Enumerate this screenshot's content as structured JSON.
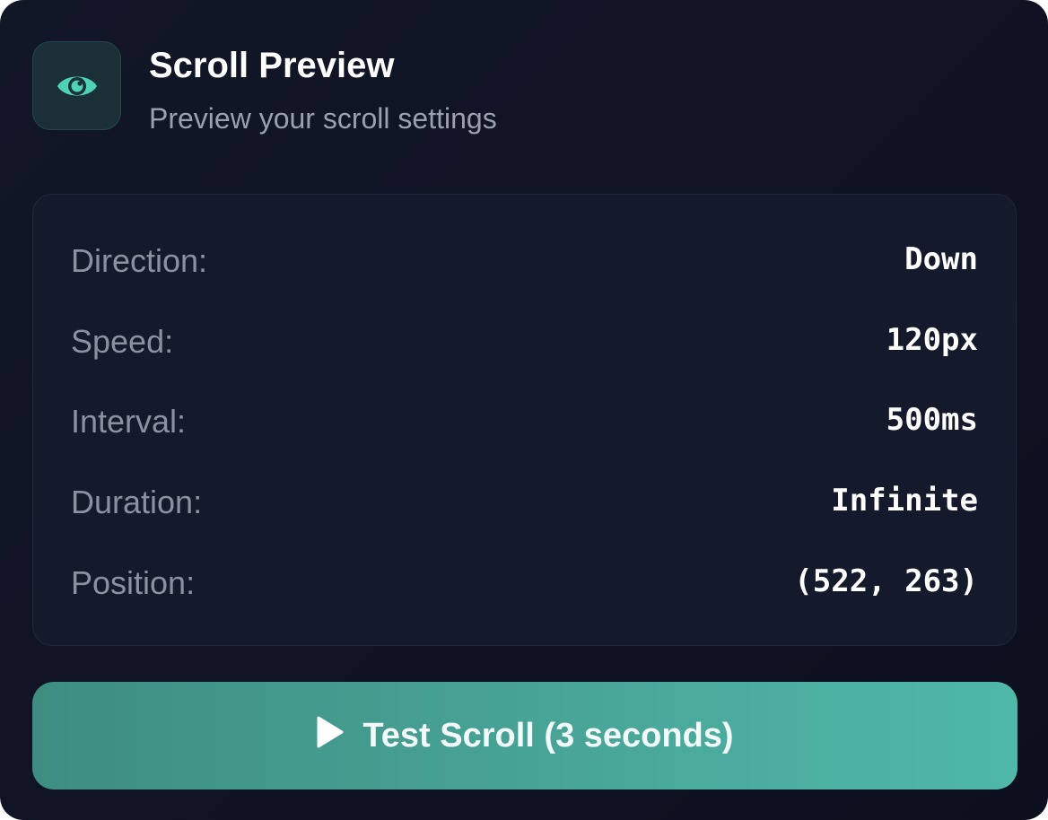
{
  "header": {
    "title": "Scroll Preview",
    "subtitle": "Preview your scroll settings",
    "icon": "eye-icon"
  },
  "settings": [
    {
      "label": "Direction:",
      "value": "Down"
    },
    {
      "label": "Speed:",
      "value": "120px"
    },
    {
      "label": "Interval:",
      "value": "500ms"
    },
    {
      "label": "Duration:",
      "value": "Infinite"
    },
    {
      "label": "Position:",
      "value": "(522, 263)"
    }
  ],
  "button": {
    "label": "Test Scroll (3 seconds)",
    "icon": "play-icon"
  },
  "colors": {
    "accent": "#4db3a5",
    "background": "#0f1324",
    "card": "#141a2b",
    "label": "#8b91a0"
  }
}
